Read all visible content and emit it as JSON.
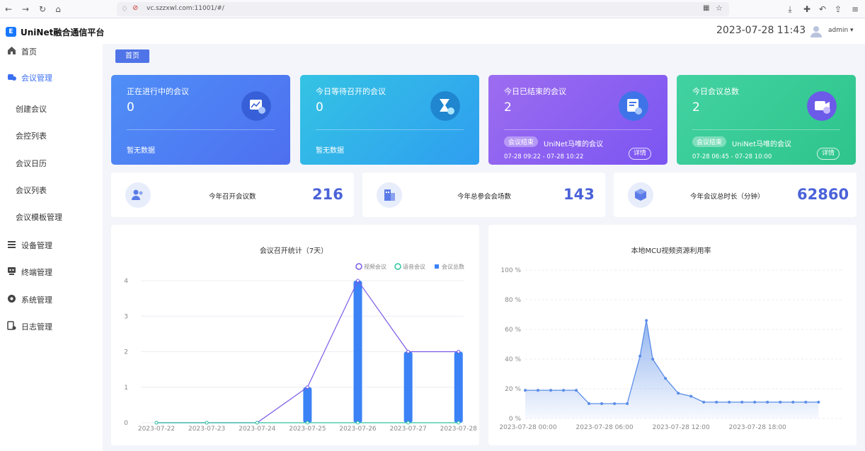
{
  "browser": {
    "url": "vc.szzxwl.com:11001/#/"
  },
  "app": {
    "title": "UniNet融合通信平台",
    "logo": "E"
  },
  "header": {
    "datetime": "2023-07-28 11:43",
    "user": "admin ▾"
  },
  "sidebar": {
    "items": [
      {
        "label": "首页",
        "icon": "home-icon"
      },
      {
        "label": "会议管理",
        "icon": "meeting-icon",
        "active": true
      },
      {
        "label": "创建会议"
      },
      {
        "label": "会控列表"
      },
      {
        "label": "会议日历"
      },
      {
        "label": "会议列表"
      },
      {
        "label": "会议模板管理"
      },
      {
        "label": "设备管理",
        "icon": "list-icon"
      },
      {
        "label": "终端管理",
        "icon": "terminal-icon"
      },
      {
        "label": "系统管理",
        "icon": "settings-icon"
      },
      {
        "label": "日志管理",
        "icon": "log-icon"
      }
    ]
  },
  "breadcrumb": "首页",
  "cards": [
    {
      "title": "正在进行中的会议",
      "value": "0",
      "no_data": "暂无数据",
      "icon": "chart-screen-icon",
      "colors": [
        "#4f8ff7",
        "#4e6ff0"
      ]
    },
    {
      "title": "今日等待召开的会议",
      "value": "0",
      "no_data": "暂无数据",
      "icon": "hourglass-icon",
      "colors": [
        "#34c3e4",
        "#2f9ef0"
      ]
    },
    {
      "title": "今日已结束的会议",
      "value": "2",
      "badge": "会议结束",
      "meeting": "UniNet马唯的会议",
      "time": "07-28 09:22 - 07-28 10:22",
      "details": "详情",
      "icon": "stop-doc-icon",
      "colors": [
        "#9d6df0",
        "#7b55f2"
      ]
    },
    {
      "title": "今日会议总数",
      "value": "2",
      "badge": "会议结束",
      "meeting": "UniNet马唯的会议",
      "time": "07-28 06:45 - 07-28 10:00",
      "details": "详情",
      "icon": "video-stats-icon",
      "colors": [
        "#42d2a2",
        "#2ec48b"
      ]
    }
  ],
  "stats": [
    {
      "label": "今年召开会议数",
      "value": "216",
      "icon": "people-icon"
    },
    {
      "label": "今年总参会会场数",
      "value": "143",
      "icon": "building-icon"
    },
    {
      "label": "今年会议总时长（分钟）",
      "value": "62860",
      "icon": "cube-icon"
    }
  ],
  "chart_data": [
    {
      "type": "bar",
      "title": "会议召开统计（7天）",
      "categories": [
        "2023-07-22",
        "2023-07-23",
        "2023-07-24",
        "2023-07-25",
        "2023-07-26",
        "2023-07-27",
        "2023-07-28"
      ],
      "ylim": [
        0,
        4
      ],
      "yticks": [
        0,
        1,
        2,
        3,
        4
      ],
      "legend_position": "top-right",
      "series": [
        {
          "name": "视频会议",
          "type": "line",
          "color": "#7a59e6",
          "values": [
            0,
            0,
            0,
            1,
            4,
            2,
            2
          ]
        },
        {
          "name": "语音会议",
          "type": "line",
          "color": "#2ec4a0",
          "values": [
            0,
            0,
            0,
            0,
            0,
            0,
            0
          ]
        },
        {
          "name": "会议总数",
          "type": "bar",
          "color": "#3b82f6",
          "values": [
            0,
            0,
            0,
            1,
            4,
            2,
            2
          ]
        }
      ]
    },
    {
      "type": "area",
      "title": "本地MCU视频资源利用率",
      "xticks": [
        "2023-07-28 00:00",
        "2023-07-28 06:00",
        "2023-07-28 12:00",
        "2023-07-28 18:00"
      ],
      "yticks": [
        "0 %",
        "20 %",
        "40 %",
        "60 %",
        "80 %",
        "100 %"
      ],
      "ylim": [
        0,
        100
      ],
      "x_hours": [
        0,
        1,
        2,
        3,
        4,
        5,
        6,
        7,
        8,
        9,
        9.5,
        10,
        11,
        12,
        13,
        14,
        15,
        16,
        17,
        18,
        19,
        20,
        21,
        22,
        23
      ],
      "values": [
        19,
        19,
        19,
        19,
        19,
        10,
        10,
        10,
        10,
        42,
        66,
        40,
        27,
        17,
        15,
        11,
        11,
        11,
        11,
        11,
        11,
        11,
        11,
        11,
        11
      ],
      "color": "#5a8de8"
    }
  ]
}
